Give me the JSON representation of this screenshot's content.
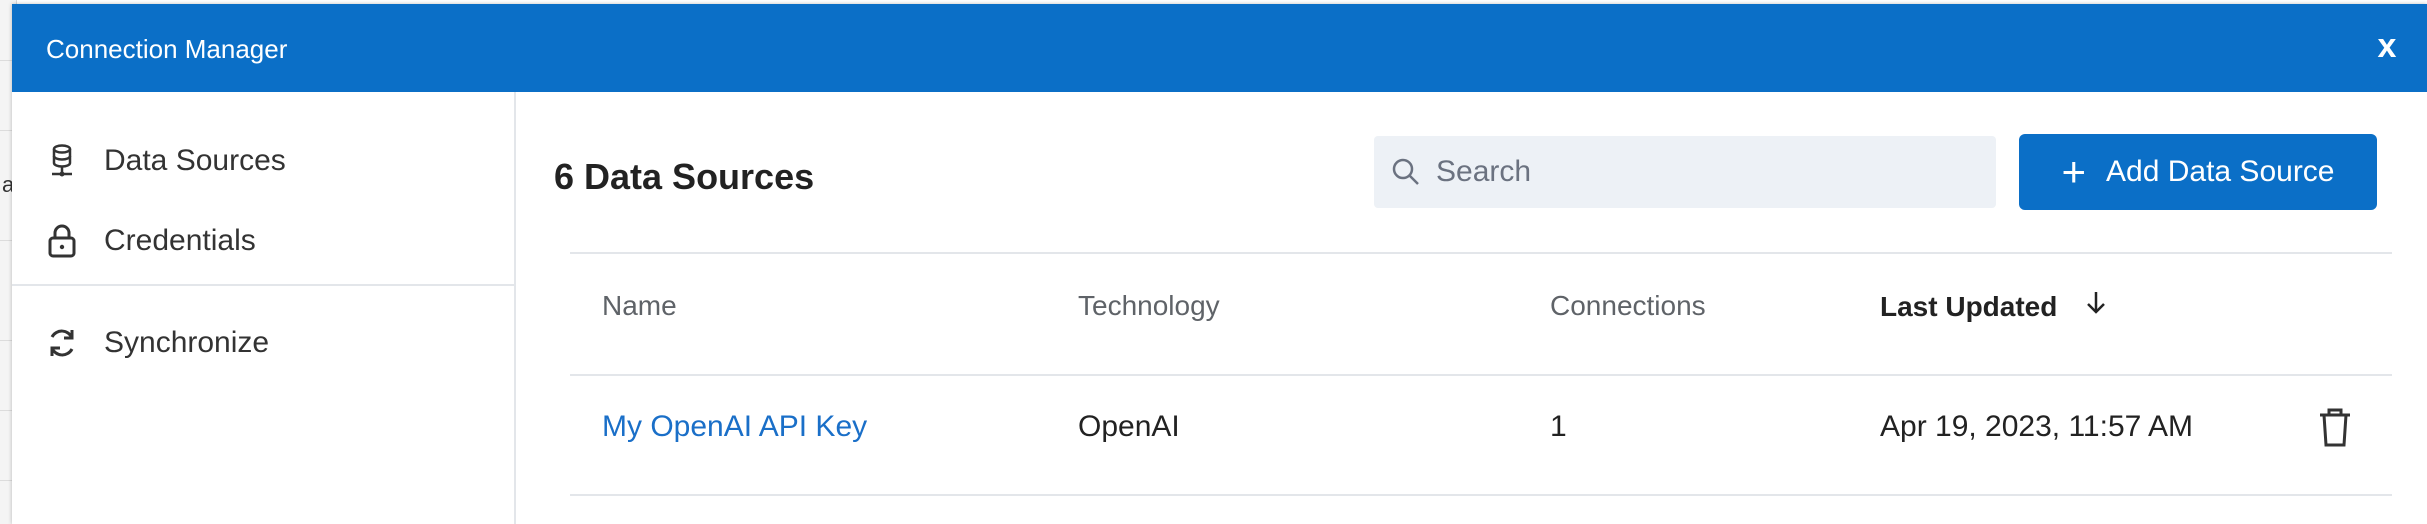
{
  "window": {
    "title": "Connection Manager",
    "close_label": "x"
  },
  "sidebar": {
    "items": [
      {
        "label": "Data Sources",
        "icon": "database-icon"
      },
      {
        "label": "Credentials",
        "icon": "lock-icon"
      },
      {
        "label": "Synchronize",
        "icon": "sync-icon"
      }
    ]
  },
  "main": {
    "heading": "6 Data Sources",
    "search": {
      "placeholder": "Search",
      "value": ""
    },
    "add_button_label": "Add Data Source",
    "table": {
      "columns": [
        "Name",
        "Technology",
        "Connections",
        "Last Updated"
      ],
      "sorted_column": "Last Updated",
      "sort_direction": "descending",
      "rows": [
        {
          "name": "My OpenAI API Key",
          "technology": "OpenAI",
          "connections": "1",
          "last_updated": "Apr 19, 2023, 11:57 AM"
        }
      ]
    }
  },
  "background": {
    "edge_char": "a"
  },
  "colors": {
    "accent": "#0b6fc7",
    "link": "#1a6fc8",
    "search_bg": "#edf1f6"
  }
}
